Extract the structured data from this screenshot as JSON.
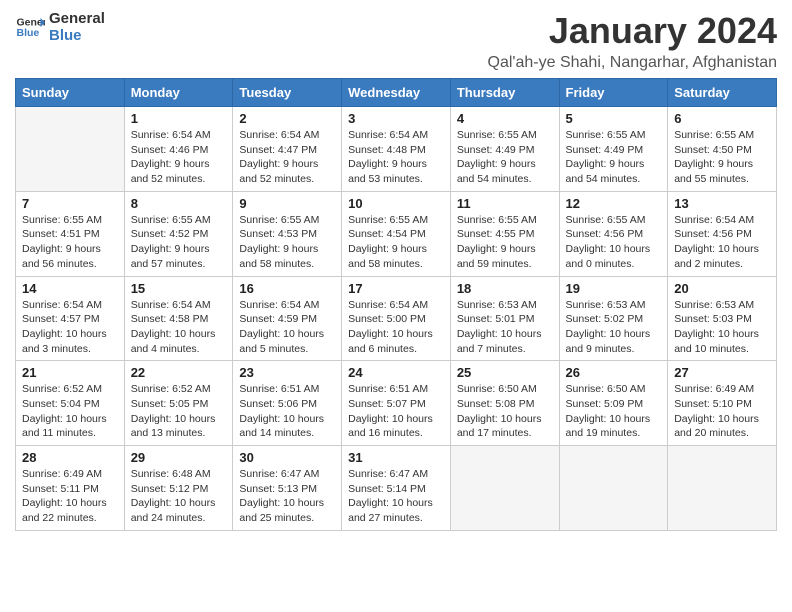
{
  "header": {
    "logo_general": "General",
    "logo_blue": "Blue",
    "title": "January 2024",
    "subtitle": "Qal'ah-ye Shahi, Nangarhar, Afghanistan"
  },
  "weekdays": [
    "Sunday",
    "Monday",
    "Tuesday",
    "Wednesday",
    "Thursday",
    "Friday",
    "Saturday"
  ],
  "weeks": [
    [
      {
        "day": "",
        "sunrise": "",
        "sunset": "",
        "daylight": ""
      },
      {
        "day": "1",
        "sunrise": "Sunrise: 6:54 AM",
        "sunset": "Sunset: 4:46 PM",
        "daylight": "Daylight: 9 hours and 52 minutes."
      },
      {
        "day": "2",
        "sunrise": "Sunrise: 6:54 AM",
        "sunset": "Sunset: 4:47 PM",
        "daylight": "Daylight: 9 hours and 52 minutes."
      },
      {
        "day": "3",
        "sunrise": "Sunrise: 6:54 AM",
        "sunset": "Sunset: 4:48 PM",
        "daylight": "Daylight: 9 hours and 53 minutes."
      },
      {
        "day": "4",
        "sunrise": "Sunrise: 6:55 AM",
        "sunset": "Sunset: 4:49 PM",
        "daylight": "Daylight: 9 hours and 54 minutes."
      },
      {
        "day": "5",
        "sunrise": "Sunrise: 6:55 AM",
        "sunset": "Sunset: 4:49 PM",
        "daylight": "Daylight: 9 hours and 54 minutes."
      },
      {
        "day": "6",
        "sunrise": "Sunrise: 6:55 AM",
        "sunset": "Sunset: 4:50 PM",
        "daylight": "Daylight: 9 hours and 55 minutes."
      }
    ],
    [
      {
        "day": "7",
        "sunrise": "Sunrise: 6:55 AM",
        "sunset": "Sunset: 4:51 PM",
        "daylight": "Daylight: 9 hours and 56 minutes."
      },
      {
        "day": "8",
        "sunrise": "Sunrise: 6:55 AM",
        "sunset": "Sunset: 4:52 PM",
        "daylight": "Daylight: 9 hours and 57 minutes."
      },
      {
        "day": "9",
        "sunrise": "Sunrise: 6:55 AM",
        "sunset": "Sunset: 4:53 PM",
        "daylight": "Daylight: 9 hours and 58 minutes."
      },
      {
        "day": "10",
        "sunrise": "Sunrise: 6:55 AM",
        "sunset": "Sunset: 4:54 PM",
        "daylight": "Daylight: 9 hours and 58 minutes."
      },
      {
        "day": "11",
        "sunrise": "Sunrise: 6:55 AM",
        "sunset": "Sunset: 4:55 PM",
        "daylight": "Daylight: 9 hours and 59 minutes."
      },
      {
        "day": "12",
        "sunrise": "Sunrise: 6:55 AM",
        "sunset": "Sunset: 4:56 PM",
        "daylight": "Daylight: 10 hours and 0 minutes."
      },
      {
        "day": "13",
        "sunrise": "Sunrise: 6:54 AM",
        "sunset": "Sunset: 4:56 PM",
        "daylight": "Daylight: 10 hours and 2 minutes."
      }
    ],
    [
      {
        "day": "14",
        "sunrise": "Sunrise: 6:54 AM",
        "sunset": "Sunset: 4:57 PM",
        "daylight": "Daylight: 10 hours and 3 minutes."
      },
      {
        "day": "15",
        "sunrise": "Sunrise: 6:54 AM",
        "sunset": "Sunset: 4:58 PM",
        "daylight": "Daylight: 10 hours and 4 minutes."
      },
      {
        "day": "16",
        "sunrise": "Sunrise: 6:54 AM",
        "sunset": "Sunset: 4:59 PM",
        "daylight": "Daylight: 10 hours and 5 minutes."
      },
      {
        "day": "17",
        "sunrise": "Sunrise: 6:54 AM",
        "sunset": "Sunset: 5:00 PM",
        "daylight": "Daylight: 10 hours and 6 minutes."
      },
      {
        "day": "18",
        "sunrise": "Sunrise: 6:53 AM",
        "sunset": "Sunset: 5:01 PM",
        "daylight": "Daylight: 10 hours and 7 minutes."
      },
      {
        "day": "19",
        "sunrise": "Sunrise: 6:53 AM",
        "sunset": "Sunset: 5:02 PM",
        "daylight": "Daylight: 10 hours and 9 minutes."
      },
      {
        "day": "20",
        "sunrise": "Sunrise: 6:53 AM",
        "sunset": "Sunset: 5:03 PM",
        "daylight": "Daylight: 10 hours and 10 minutes."
      }
    ],
    [
      {
        "day": "21",
        "sunrise": "Sunrise: 6:52 AM",
        "sunset": "Sunset: 5:04 PM",
        "daylight": "Daylight: 10 hours and 11 minutes."
      },
      {
        "day": "22",
        "sunrise": "Sunrise: 6:52 AM",
        "sunset": "Sunset: 5:05 PM",
        "daylight": "Daylight: 10 hours and 13 minutes."
      },
      {
        "day": "23",
        "sunrise": "Sunrise: 6:51 AM",
        "sunset": "Sunset: 5:06 PM",
        "daylight": "Daylight: 10 hours and 14 minutes."
      },
      {
        "day": "24",
        "sunrise": "Sunrise: 6:51 AM",
        "sunset": "Sunset: 5:07 PM",
        "daylight": "Daylight: 10 hours and 16 minutes."
      },
      {
        "day": "25",
        "sunrise": "Sunrise: 6:50 AM",
        "sunset": "Sunset: 5:08 PM",
        "daylight": "Daylight: 10 hours and 17 minutes."
      },
      {
        "day": "26",
        "sunrise": "Sunrise: 6:50 AM",
        "sunset": "Sunset: 5:09 PM",
        "daylight": "Daylight: 10 hours and 19 minutes."
      },
      {
        "day": "27",
        "sunrise": "Sunrise: 6:49 AM",
        "sunset": "Sunset: 5:10 PM",
        "daylight": "Daylight: 10 hours and 20 minutes."
      }
    ],
    [
      {
        "day": "28",
        "sunrise": "Sunrise: 6:49 AM",
        "sunset": "Sunset: 5:11 PM",
        "daylight": "Daylight: 10 hours and 22 minutes."
      },
      {
        "day": "29",
        "sunrise": "Sunrise: 6:48 AM",
        "sunset": "Sunset: 5:12 PM",
        "daylight": "Daylight: 10 hours and 24 minutes."
      },
      {
        "day": "30",
        "sunrise": "Sunrise: 6:47 AM",
        "sunset": "Sunset: 5:13 PM",
        "daylight": "Daylight: 10 hours and 25 minutes."
      },
      {
        "day": "31",
        "sunrise": "Sunrise: 6:47 AM",
        "sunset": "Sunset: 5:14 PM",
        "daylight": "Daylight: 10 hours and 27 minutes."
      },
      {
        "day": "",
        "sunrise": "",
        "sunset": "",
        "daylight": ""
      },
      {
        "day": "",
        "sunrise": "",
        "sunset": "",
        "daylight": ""
      },
      {
        "day": "",
        "sunrise": "",
        "sunset": "",
        "daylight": ""
      }
    ]
  ]
}
